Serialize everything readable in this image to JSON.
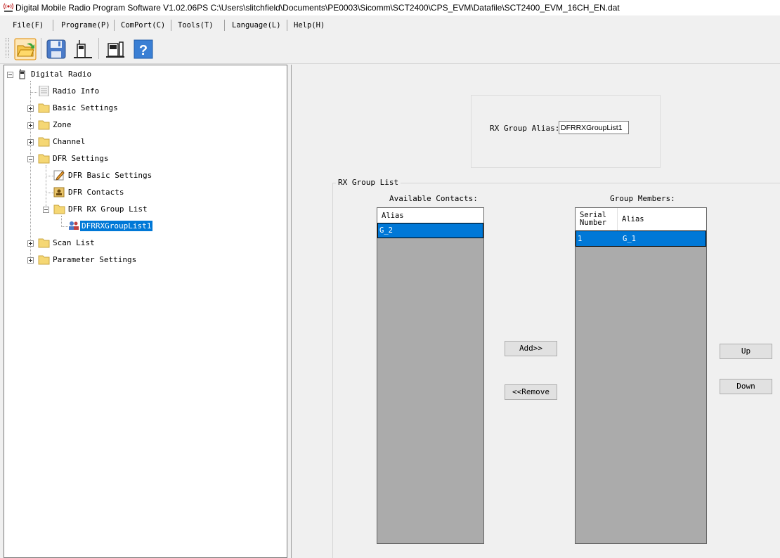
{
  "window": {
    "title": "Digital Mobile Radio Program Software V1.02.06PS C:\\Users\\slitchfield\\Documents\\PE0003\\Sicomm\\SCT2400\\CPS_EVM\\Datafile\\SCT2400_EVM_16CH_EN.dat",
    "app_icon": "radio-waves-icon"
  },
  "menu": {
    "items": [
      "File(F)",
      "Programe(P)",
      "ComPort(C)",
      "Tools(T)",
      "Language(L)",
      "Help(H)"
    ]
  },
  "toolbar": {
    "buttons": [
      "open-folder-icon",
      "save-disk-icon",
      "read-radio-icon",
      "write-radio-icon",
      "help-icon"
    ]
  },
  "tree": {
    "root": "Digital Radio",
    "radio_info": "Radio Info",
    "basic_settings": "Basic Settings",
    "zone": "Zone",
    "channel": "Channel",
    "dfr_settings": "DFR Settings",
    "dfr_basic_settings": "DFR Basic Settings",
    "dfr_contacts": "DFR Contacts",
    "dfr_rx_group_list": "DFR RX Group List",
    "dfr_rx_group_list_1": "DFRRXGroupList1",
    "scan_list": "Scan List",
    "parameter_settings": "Parameter Settings"
  },
  "form": {
    "alias_label": "RX Group Alias:",
    "alias_value": "DFRRXGroupList1",
    "group_title": "RX Group List",
    "available_label": "Available Contacts:",
    "members_label": "Group Members:",
    "available": {
      "header_alias": "Alias",
      "rows": [
        {
          "alias": "G_2"
        }
      ]
    },
    "members": {
      "header_serial_line1": "Serial",
      "header_serial_line2": "Number",
      "header_alias": "Alias",
      "rows": [
        {
          "serial": "1",
          "alias": "G_1"
        }
      ]
    },
    "add_button": "Add>>",
    "remove_button": "<<Remove",
    "up_button": "Up",
    "down_button": "Down"
  },
  "colors": {
    "selection": "#0078d7",
    "list_background": "#ababab",
    "folder": "#f5d774"
  }
}
